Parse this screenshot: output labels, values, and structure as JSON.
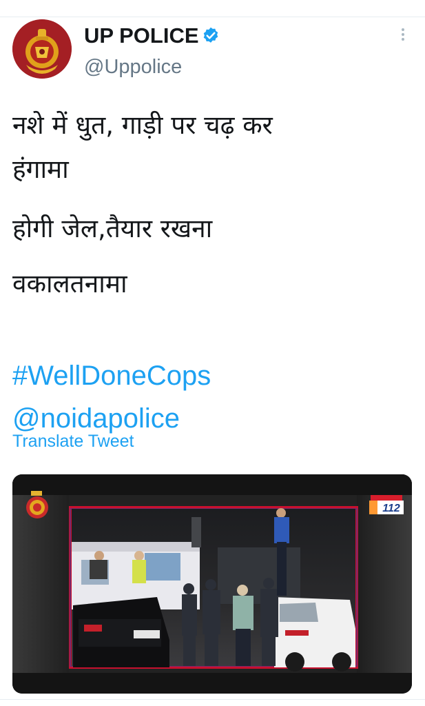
{
  "tweet": {
    "display_name": "UP POLICE",
    "handle": "@Uppolice",
    "verified": true,
    "text_lines": [
      "नशे में धुत, गाड़ी पर चढ़ कर",
      "हंगामा",
      "होगी जेल,तैयार रखना",
      "वकालतनामा"
    ],
    "hashtag": "#WellDoneCops",
    "mention": "@noidapolice",
    "translate_label": "Translate Tweet"
  },
  "media": {
    "emblem": "up-police-emblem",
    "badge": "112"
  },
  "colors": {
    "link": "#1da1f2",
    "name": "#14171a",
    "handle": "#657786",
    "video_frame_border": "#c8102e"
  },
  "icons": {
    "verified": "verified-badge-icon",
    "more": "more-options-icon"
  }
}
